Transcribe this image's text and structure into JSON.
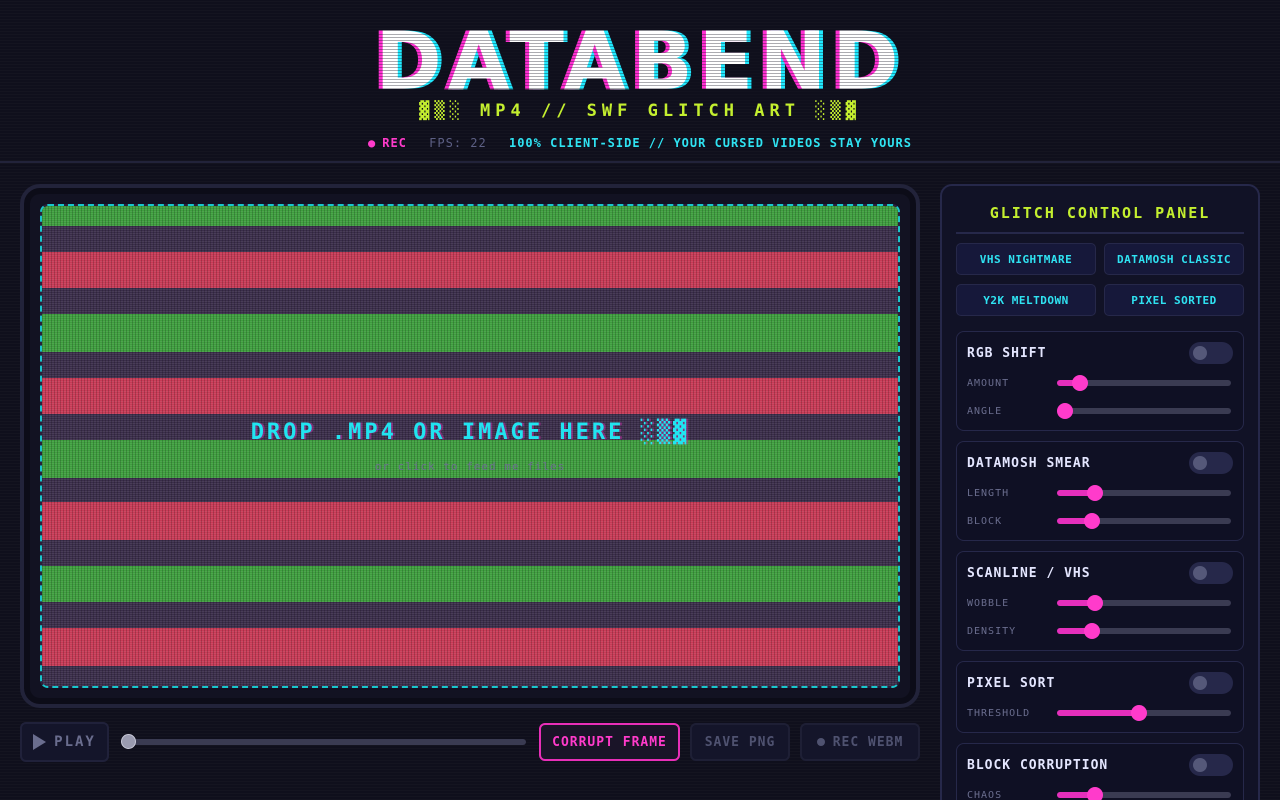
{
  "header": {
    "logo": "DATABEND",
    "subtitle": "▓▒░ MP4 // SWF GLITCH ART ░▒▓",
    "rec_label": "REC",
    "fps_label": "FPS: 22",
    "privacy_note": "100% CLIENT-SIDE // YOUR CURSED VIDEOS STAY YOURS"
  },
  "viewport": {
    "drop_text": "DROP .MP4 OR IMAGE HERE ░▒▓",
    "drop_subtext": "or click to feed me files",
    "band_colors": [
      "#3e9e3e",
      "#3a2d4a",
      "#c83a56",
      "#3a2d4a",
      "#3e9e3e",
      "#3a2d4a",
      "#c83a56",
      "#3a2d4a",
      "#3e9e3e",
      "#3a2d4a",
      "#c83a56",
      "#3a2d4a",
      "#3e9e3e",
      "#3a2d4a",
      "#c83a56",
      "#3a2d4a"
    ]
  },
  "transport": {
    "play_label": "PLAY",
    "corrupt_label": "CORRUPT FRAME",
    "save_label": "SAVE PNG",
    "rec_webm_label": "REC WEBM",
    "progress": 0
  },
  "panel": {
    "title": "GLITCH CONTROL PANEL",
    "presets": [
      "VHS NIGHTMARE",
      "DATAMOSH CLASSIC",
      "Y2K MELTDOWN",
      "PIXEL SORTED"
    ],
    "effects": [
      {
        "name": "RGB SHIFT",
        "enabled": false,
        "params": [
          {
            "label": "AMOUNT",
            "value": 0.13
          },
          {
            "label": "ANGLE",
            "value": 0.0
          }
        ]
      },
      {
        "name": "DATAMOSH SMEAR",
        "enabled": false,
        "params": [
          {
            "label": "LENGTH",
            "value": 0.22
          },
          {
            "label": "BLOCK",
            "value": 0.2
          }
        ]
      },
      {
        "name": "SCANLINE / VHS",
        "enabled": false,
        "params": [
          {
            "label": "WOBBLE",
            "value": 0.22
          },
          {
            "label": "DENSITY",
            "value": 0.2
          }
        ]
      },
      {
        "name": "PIXEL SORT",
        "enabled": false,
        "params": [
          {
            "label": "THRESHOLD",
            "value": 0.47
          }
        ]
      },
      {
        "name": "BLOCK CORRUPTION",
        "enabled": false,
        "params": [
          {
            "label": "CHAOS",
            "value": 0.22
          }
        ]
      }
    ]
  },
  "colors": {
    "accent_pink": "#ff3bcb",
    "accent_cyan": "#21e9ff",
    "accent_lime": "#c4ef2f",
    "background": "#0f0f1c"
  }
}
